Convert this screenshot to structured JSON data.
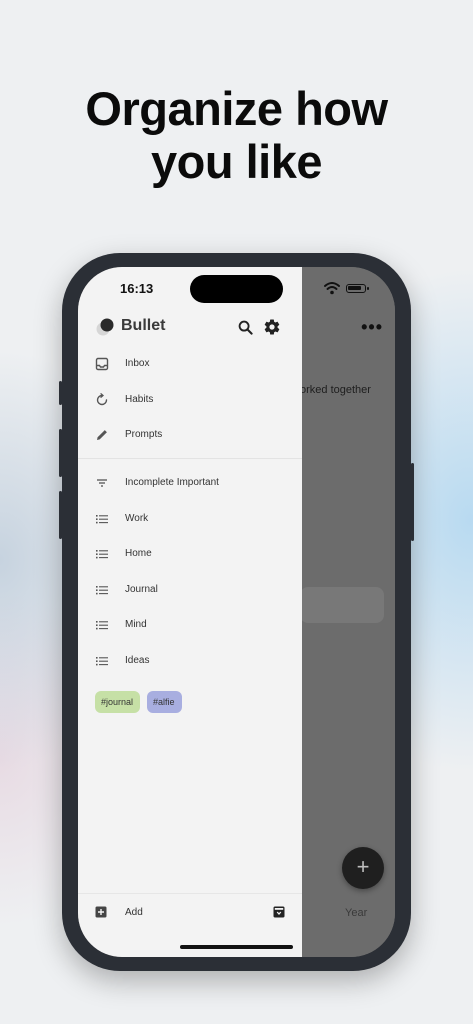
{
  "headline": {
    "line1": "Organize how",
    "line2": "you like"
  },
  "status_bar": {
    "time": "16:13"
  },
  "app": {
    "title": "Bullet"
  },
  "drawer": {
    "primary": [
      {
        "label": "Inbox",
        "icon": "inbox-icon"
      },
      {
        "label": "Habits",
        "icon": "habit-loop-icon"
      },
      {
        "label": "Prompts",
        "icon": "pencil-icon"
      }
    ],
    "lists": [
      {
        "label": "Incomplete Important",
        "icon": "filter-icon"
      },
      {
        "label": "Work",
        "icon": "list-icon"
      },
      {
        "label": "Home",
        "icon": "list-icon"
      },
      {
        "label": "Journal",
        "icon": "list-icon"
      },
      {
        "label": "Mind",
        "icon": "list-icon"
      },
      {
        "label": "Ideas",
        "icon": "list-icon"
      }
    ],
    "tags": [
      {
        "label": "#journal",
        "color": "#c6e0a6"
      },
      {
        "label": "#alfie",
        "color": "#a8aee0"
      }
    ],
    "add_label": "Add"
  },
  "background_screen": {
    "snippet": "orked together",
    "tab_label": "Year",
    "fab_symbol": "+",
    "more_symbol": "•••"
  }
}
